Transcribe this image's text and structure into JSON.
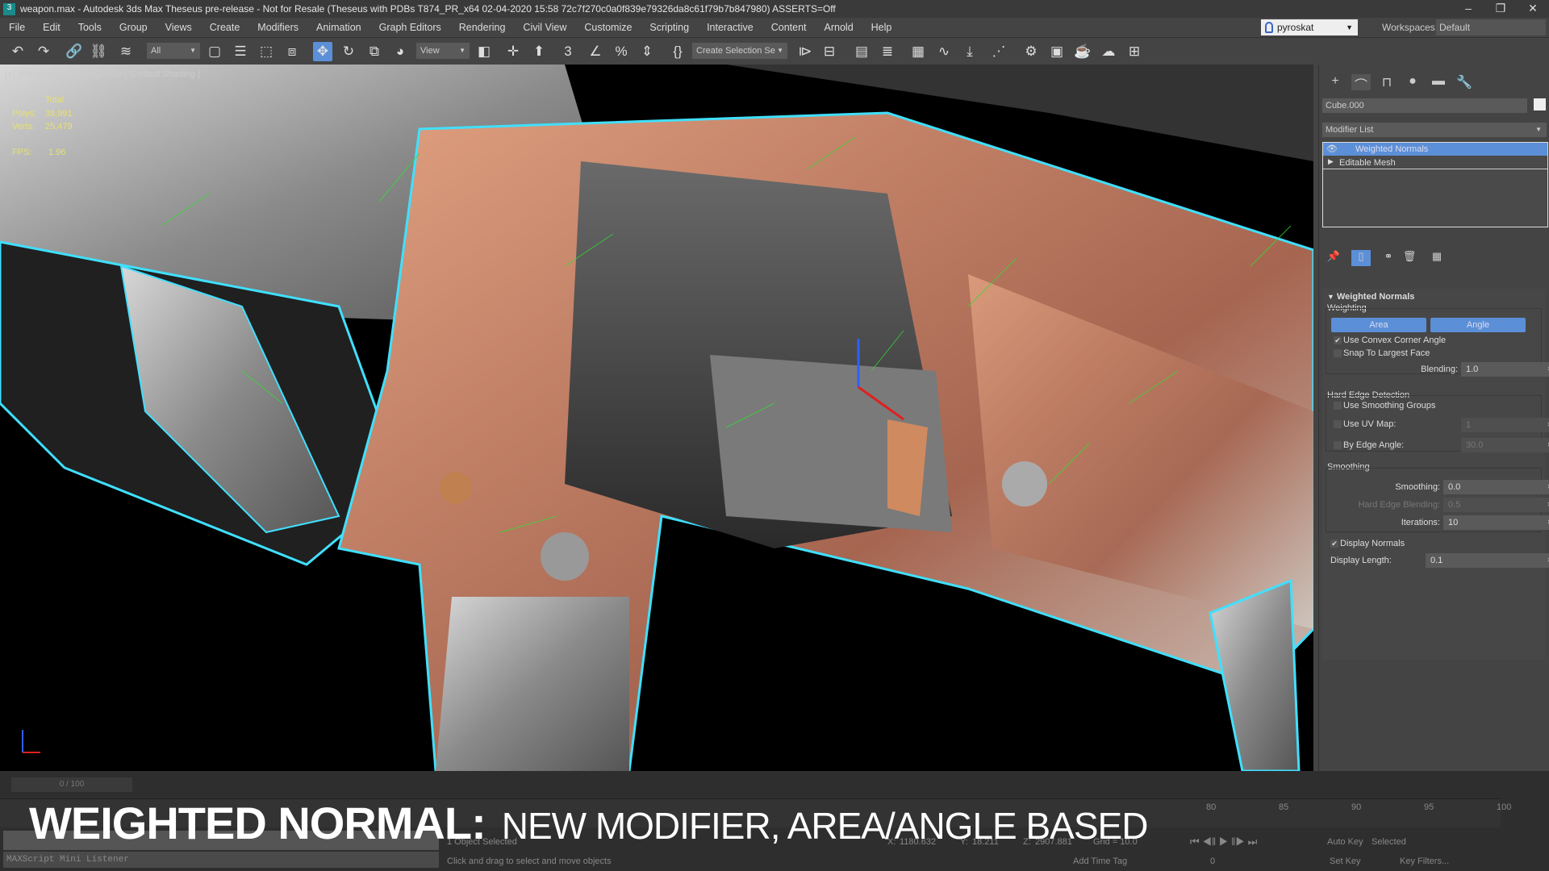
{
  "window": {
    "title": "weapon.max - Autodesk 3ds Max Theseus pre-release - Not for Resale (Theseus with PDBs T874_PR_x64 02-04-2020 15:58 72c7f270c0a0f839e79326da8c61f79b7b847980) ASSERTS=Off",
    "app_icon": "3"
  },
  "menu": [
    "File",
    "Edit",
    "Tools",
    "Group",
    "Views",
    "Create",
    "Modifiers",
    "Animation",
    "Graph Editors",
    "Rendering",
    "Civil View",
    "Customize",
    "Scripting",
    "Interactive",
    "Content",
    "Arnold",
    "Help"
  ],
  "user": {
    "name": "pyroskat",
    "workspaces_label": "Workspaces:",
    "workspace": "Default"
  },
  "toolbar": {
    "filter": "All",
    "ref_coord": "View",
    "selection_set": "Create Selection Se"
  },
  "viewport": {
    "label": "[+] [Perspective] [High Quality ] [Default Shading ]",
    "stats": {
      "total_label": "Total",
      "polys_label": "Polys:",
      "polys": "38,991",
      "verts_label": "Verts:",
      "verts": "25,479",
      "fps_label": "FPS:",
      "fps": "1.96"
    }
  },
  "panel": {
    "object_name": "Cube.000",
    "modifier_list": "Modifier List",
    "stack": [
      {
        "label": "Weighted Normals",
        "selected": true
      },
      {
        "label": "Editable Mesh",
        "selected": false
      }
    ],
    "rollout_title": "Weighted Normals",
    "weighting": {
      "title": "Weighting",
      "area": "Area",
      "angle": "Angle",
      "convex": "Use Convex Corner Angle",
      "convex_checked": true,
      "snap": "Snap To Largest Face",
      "snap_checked": false,
      "blending_label": "Blending:",
      "blending": "1.0"
    },
    "hard_edge": {
      "title": "Hard Edge Detection",
      "smoothing_groups": "Use Smoothing Groups",
      "uv_map_label": "Use UV Map:",
      "uv_map": "1",
      "edge_angle_label": "By Edge Angle:",
      "edge_angle": "30.0"
    },
    "smoothing": {
      "title": "Smoothing",
      "smoothing_label": "Smoothing:",
      "smoothing": "0.0",
      "hard_blend_label": "Hard Edge Blending:",
      "hard_blend": "0.5",
      "iterations_label": "Iterations:",
      "iterations": "10"
    },
    "display": {
      "display_normals": "Display Normals",
      "display_checked": true,
      "length_label": "Display Length:",
      "length": "0.1"
    }
  },
  "timeline": {
    "frame": "0 / 100",
    "ticks": [
      "80",
      "85",
      "90",
      "95",
      "100"
    ],
    "listener": "MAXScript Mini Listener",
    "selected": "1 Object Selected",
    "prompt": "Click and drag to select and move objects",
    "x_label": "X:",
    "x": "1180.632",
    "y_label": "Y:",
    "y": "18.211",
    "z_label": "Z:",
    "z": "2907.881",
    "grid": "Grid = 10.0",
    "auto_key": "Auto Key",
    "selected_dd": "Selected",
    "set_key": "Set Key",
    "key_filters": "Key Filters...",
    "add_time_tag": "Add Time Tag",
    "frame_field": "0"
  },
  "caption": {
    "main": "WEIGHTED NORMAL:",
    "sub": "NEW MODIFIER, AREA/ANGLE BASED"
  },
  "colors": {
    "accent": "#5b8fd8",
    "normals": "#33dd33",
    "selection_outline": "#40e0ff",
    "copper": "#c07050"
  }
}
